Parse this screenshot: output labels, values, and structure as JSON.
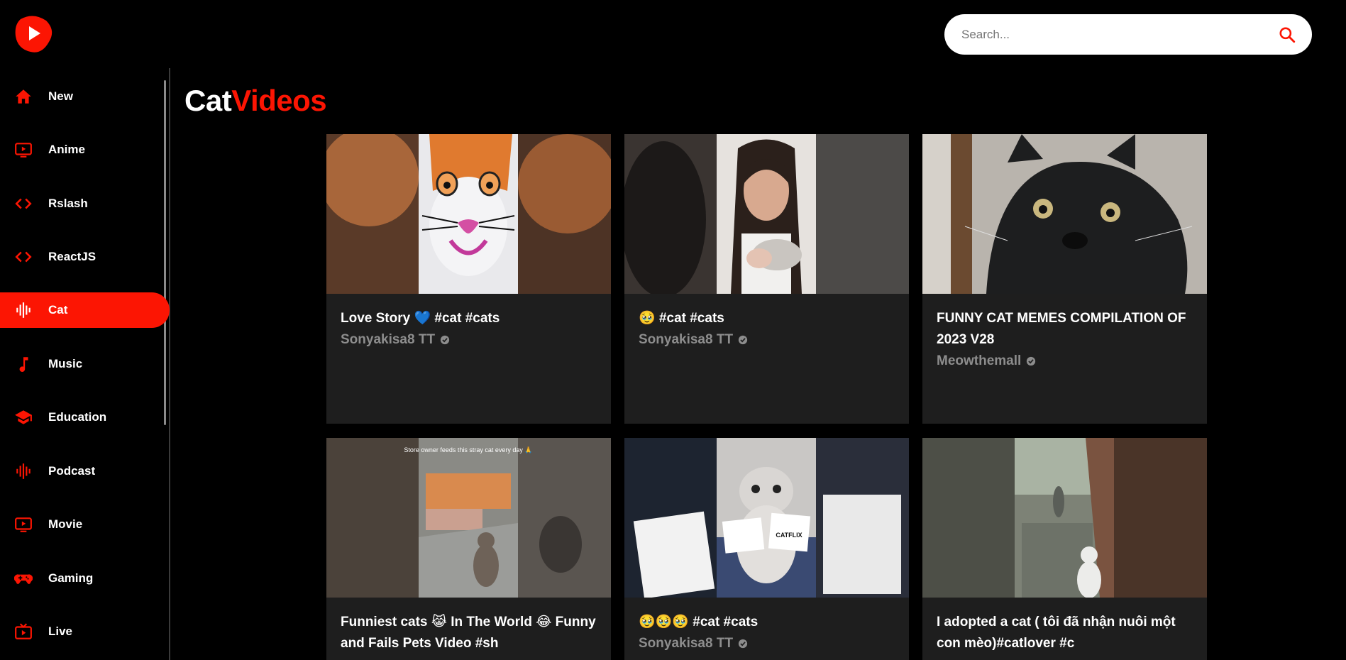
{
  "search": {
    "placeholder": "Search..."
  },
  "sidebar": {
    "items": [
      {
        "label": "New",
        "icon": "home-icon",
        "active": false
      },
      {
        "label": "Anime",
        "icon": "tv-play-icon",
        "active": false
      },
      {
        "label": "Rslash",
        "icon": "code-icon",
        "active": false
      },
      {
        "label": "ReactJS",
        "icon": "code-icon",
        "active": false
      },
      {
        "label": "Cat",
        "icon": "graphic-eq-icon",
        "active": true
      },
      {
        "label": "Music",
        "icon": "music-note-icon",
        "active": false
      },
      {
        "label": "Education",
        "icon": "school-icon",
        "active": false
      },
      {
        "label": "Podcast",
        "icon": "graphic-eq-icon",
        "active": false
      },
      {
        "label": "Movie",
        "icon": "tv-play-icon",
        "active": false
      },
      {
        "label": "Gaming",
        "icon": "gamepad-icon",
        "active": false
      },
      {
        "label": "Live",
        "icon": "live-tv-icon",
        "active": false
      }
    ]
  },
  "page": {
    "title_main": "Cat",
    "title_accent": "Videos"
  },
  "colors": {
    "accent": "#fc1503",
    "background": "#000000",
    "card": "#1e1e1e",
    "muted": "#8d8d8d"
  },
  "videos": [
    {
      "title": "Love Story 💙 #cat #cats",
      "channel": "Sonyakisa8 TT"
    },
    {
      "title": "🥹 #cat #cats",
      "channel": "Sonyakisa8 TT"
    },
    {
      "title": "FUNNY CAT MEMES COMPILATION OF 2023 V28",
      "channel": "Meowthemall"
    },
    {
      "title": "Funniest cats 😹 In The World 😂 Funny and Fails Pets Video #sh",
      "channel": ""
    },
    {
      "title": "🥹🥹🥹 #cat #cats",
      "channel": "Sonyakisa8 TT"
    },
    {
      "title": "I adopted a cat ( tôi đã nhận nuôi một con mèo)#catlover #c",
      "channel": ""
    }
  ],
  "thumb_texts": {
    "stray": "Store owner feeds this stray cat every day 🙏",
    "catflix": "CATFLIX"
  }
}
